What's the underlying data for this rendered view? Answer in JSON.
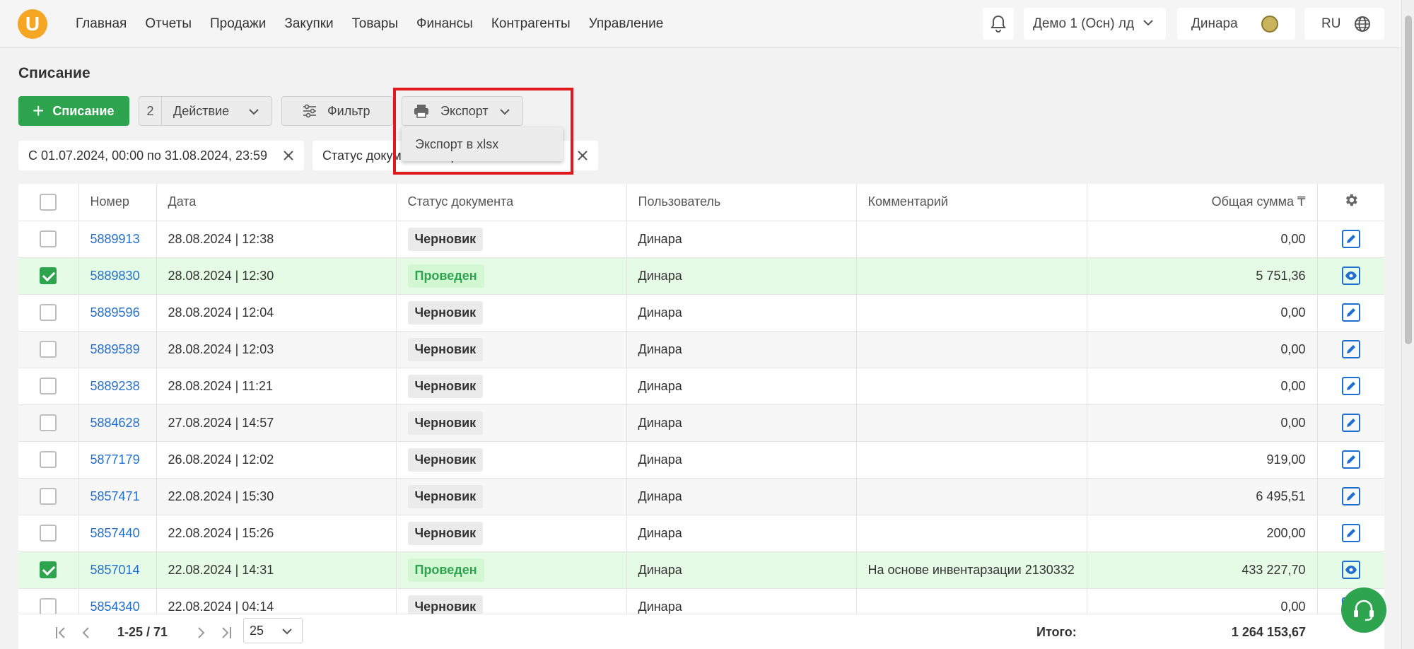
{
  "app": {
    "logo_letter": "U",
    "brand_color": "#f5a623",
    "accent": "#2ea44f"
  },
  "nav": [
    "Главная",
    "Отчеты",
    "Продажи",
    "Закупки",
    "Товары",
    "Финансы",
    "Контрагенты",
    "Управление"
  ],
  "header": {
    "org": "Демо 1 (Осн) лд",
    "user": "Динара",
    "lang": "RU"
  },
  "page": {
    "title": "Списание"
  },
  "toolbar": {
    "add_label": "Списание",
    "action_count": "2",
    "action_label": "Действие",
    "filter_label": "Фильтр",
    "export_label": "Экспорт"
  },
  "export_menu": {
    "items": [
      "Экспорт в xlsx"
    ]
  },
  "chips": [
    "С 01.07.2024, 00:00 по 31.08.2024, 23:59",
    "Статус документа: Черновик"
  ],
  "table": {
    "columns": [
      "Номер",
      "Дата",
      "Статус документа",
      "Пользователь",
      "Комментарий",
      "Общая сумма ₸"
    ],
    "rows": [
      {
        "checked": false,
        "num": "5889913",
        "date": "28.08.2024 | 12:38",
        "status": "Черновик",
        "user": "Динара",
        "comment": "",
        "sum": "0,00",
        "action": "edit-icon"
      },
      {
        "checked": true,
        "num": "5889830",
        "date": "28.08.2024 | 12:30",
        "status": "Проведен",
        "user": "Динара",
        "comment": "",
        "sum": "5 751,36",
        "action": "eye-icon"
      },
      {
        "checked": false,
        "num": "5889596",
        "date": "28.08.2024 | 12:04",
        "status": "Черновик",
        "user": "Динара",
        "comment": "",
        "sum": "0,00",
        "action": "edit-icon"
      },
      {
        "checked": false,
        "num": "5889589",
        "date": "28.08.2024 | 12:03",
        "status": "Черновик",
        "user": "Динара",
        "comment": "",
        "sum": "0,00",
        "action": "edit-icon"
      },
      {
        "checked": false,
        "num": "5889238",
        "date": "28.08.2024 | 11:21",
        "status": "Черновик",
        "user": "Динара",
        "comment": "",
        "sum": "0,00",
        "action": "edit-icon"
      },
      {
        "checked": false,
        "num": "5884628",
        "date": "27.08.2024 | 14:57",
        "status": "Черновик",
        "user": "Динара",
        "comment": "",
        "sum": "0,00",
        "action": "edit-icon"
      },
      {
        "checked": false,
        "num": "5877179",
        "date": "26.08.2024 | 12:02",
        "status": "Черновик",
        "user": "Динара",
        "comment": "",
        "sum": "919,00",
        "action": "edit-icon"
      },
      {
        "checked": false,
        "num": "5857471",
        "date": "22.08.2024 | 15:30",
        "status": "Черновик",
        "user": "Динара",
        "comment": "",
        "sum": "6 495,51",
        "action": "edit-icon"
      },
      {
        "checked": false,
        "num": "5857440",
        "date": "22.08.2024 | 15:26",
        "status": "Черновик",
        "user": "Динара",
        "comment": "",
        "sum": "200,00",
        "action": "edit-icon"
      },
      {
        "checked": true,
        "num": "5857014",
        "date": "22.08.2024 | 14:31",
        "status": "Проведен",
        "user": "Динара",
        "comment": "На основе инвентарзации 2130332",
        "sum": "433 227,70",
        "action": "eye-icon"
      },
      {
        "checked": false,
        "num": "5854340",
        "date": "22.08.2024 | 04:14",
        "status": "Черновик",
        "user": "Динара",
        "comment": "",
        "sum": "0,00",
        "action": "edit-icon"
      }
    ]
  },
  "footer": {
    "range": "1-25 / 71",
    "page_size": "25",
    "total_label": "Итого:",
    "total_value": "1 264 153,67"
  }
}
